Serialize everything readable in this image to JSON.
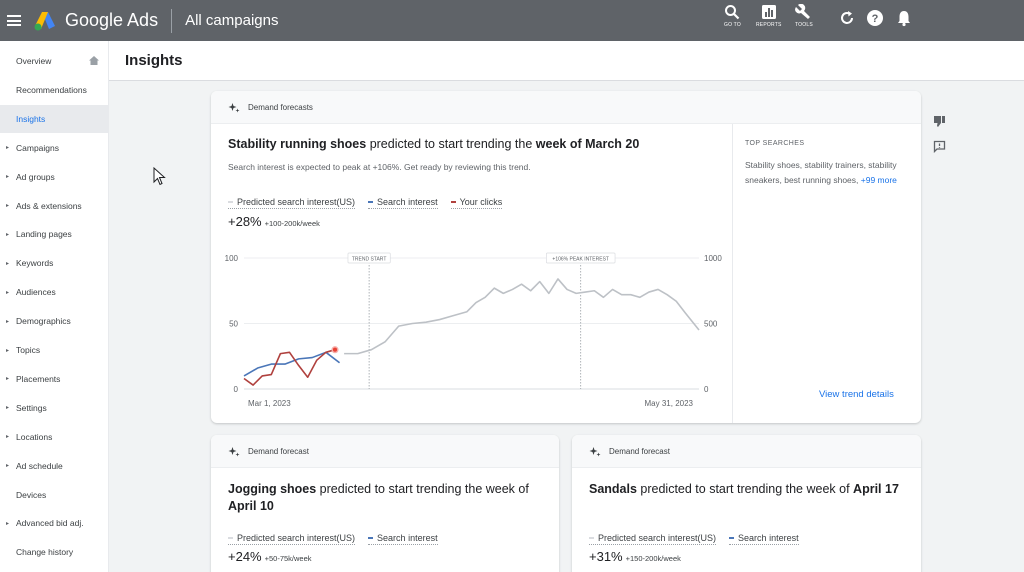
{
  "topbar": {
    "brand": "Google Ads",
    "campaign_selector": "All campaigns",
    "buttons": [
      {
        "label": "GO TO",
        "icon": "search-icon"
      },
      {
        "label": "REPORTS",
        "icon": "reports-icon"
      },
      {
        "label": "TOOLS",
        "icon": "wrench-icon"
      }
    ]
  },
  "sidebar": {
    "items": [
      {
        "label": "Overview",
        "caret": false,
        "active": false
      },
      {
        "label": "Recommendations",
        "caret": false,
        "active": false
      },
      {
        "label": "Insights",
        "caret": false,
        "active": true
      },
      {
        "label": "Campaigns",
        "caret": true,
        "active": false
      },
      {
        "label": "Ad groups",
        "caret": true,
        "active": false
      },
      {
        "label": "Ads & extensions",
        "caret": true,
        "active": false
      },
      {
        "label": "Landing pages",
        "caret": true,
        "active": false
      },
      {
        "label": "Keywords",
        "caret": true,
        "active": false
      },
      {
        "label": "Audiences",
        "caret": true,
        "active": false
      },
      {
        "label": "Demographics",
        "caret": true,
        "active": false
      },
      {
        "label": "Topics",
        "caret": true,
        "active": false
      },
      {
        "label": "Placements",
        "caret": true,
        "active": false
      },
      {
        "label": "Settings",
        "caret": true,
        "active": false
      },
      {
        "label": "Locations",
        "caret": true,
        "active": false
      },
      {
        "label": "Ad schedule",
        "caret": true,
        "active": false
      },
      {
        "label": "Devices",
        "caret": false,
        "active": false
      },
      {
        "label": "Advanced bid adj.",
        "caret": true,
        "active": false
      },
      {
        "label": "Change history",
        "caret": false,
        "active": false
      }
    ]
  },
  "page": {
    "title": "Insights"
  },
  "main_card": {
    "header": "Demand forecasts",
    "headline_bold": "Stability running shoes",
    "headline_mid": " predicted to start trending the ",
    "headline_bold2": "week of March 20",
    "subline": "Search interest is expected to peak at +106%. Get ready by reviewing this trend.",
    "legend": [
      "Predicted search interest(US)",
      "Search interest",
      "Your clicks"
    ],
    "big_value": "+28%",
    "big_range": "+100-200k/week",
    "top_searches_heading": "TOP SEARCHES",
    "top_searches_text": "Stability shoes, stability trainers, stability sneakers, best running shoes, ",
    "top_searches_more": "+99 more",
    "view_details": "View trend details"
  },
  "chart_data": {
    "type": "line",
    "x_start_label": "Mar 1, 2023",
    "x_end_label": "May 31, 2023",
    "y_left_ticks": [
      "100",
      "50",
      "0"
    ],
    "y_right_ticks": [
      "1000",
      "500",
      "0"
    ],
    "ylim_left": [
      0,
      100
    ],
    "ylim_right": [
      0,
      1000
    ],
    "grid": true,
    "annotations": [
      "TREND START",
      "+106% PEAK INTEREST"
    ],
    "series": [
      {
        "name": "Predicted search interest(US)",
        "color": "#bdc1c6",
        "x": [
          0.22,
          0.25,
          0.28,
          0.31,
          0.34,
          0.37,
          0.4,
          0.43,
          0.46,
          0.49,
          0.51,
          0.53,
          0.55,
          0.57,
          0.59,
          0.61,
          0.63,
          0.65,
          0.67,
          0.69,
          0.71,
          0.73,
          0.75,
          0.77,
          0.79,
          0.81,
          0.83,
          0.85,
          0.87,
          0.89,
          0.91,
          0.93,
          0.95,
          0.97,
          1.0
        ],
        "values": [
          27,
          27,
          30,
          36,
          48,
          50,
          51,
          53,
          56,
          59,
          66,
          70,
          77,
          73,
          76,
          80,
          75,
          82,
          73,
          84,
          76,
          73,
          74,
          75,
          70,
          76,
          72,
          72,
          70,
          74,
          76,
          72,
          67,
          58,
          45
        ]
      },
      {
        "name": "Search interest",
        "color": "#4a76b8",
        "x": [
          0.0,
          0.03,
          0.06,
          0.09,
          0.12,
          0.15,
          0.18,
          0.21
        ],
        "values": [
          10,
          16,
          19,
          19,
          23,
          24,
          28,
          20
        ],
        "marker": false
      },
      {
        "name": "Your clicks",
        "color": "#b0413e",
        "x": [
          0.0,
          0.02,
          0.04,
          0.06,
          0.08,
          0.1,
          0.12,
          0.14,
          0.16,
          0.18,
          0.2
        ],
        "values": [
          8,
          3,
          10,
          11,
          27,
          28,
          18,
          9,
          22,
          28,
          30
        ],
        "marker": true
      }
    ]
  },
  "card2": {
    "header": "Demand forecast",
    "headline_bold": "Jogging shoes",
    "headline_mid": " predicted to start trending the week of ",
    "headline_bold2": "April 10",
    "legend": [
      "Predicted search interest(US)",
      "Search interest"
    ],
    "big_value": "+24%",
    "big_range": "+50-75k/week"
  },
  "card3": {
    "header": "Demand forecast",
    "headline_bold": "Sandals",
    "headline_mid": " predicted to start trending the week of ",
    "headline_bold2": "April 17",
    "legend": [
      "Predicted search interest(US)",
      "Search interest"
    ],
    "big_value": "+31%",
    "big_range": "+150-200k/week"
  },
  "colors": {
    "topbar": "#5f6368",
    "accent": "#1a73e8",
    "predicted": "#bdc1c6",
    "search": "#4a76b8",
    "clicks": "#b0413e"
  }
}
